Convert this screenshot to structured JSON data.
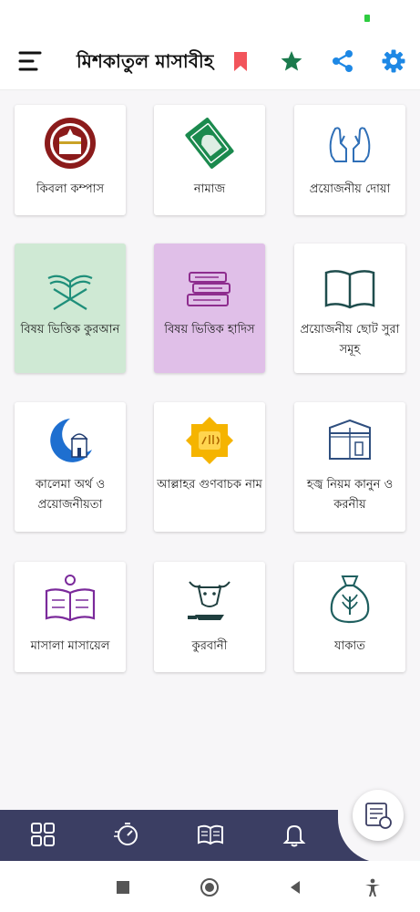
{
  "app": {
    "title": "মিশকাতুল মাসাবীহ"
  },
  "colors": {
    "accent_blue": "#1e88e5",
    "bookmark_red": "#f2545b",
    "star_green": "#1b7a4d",
    "nav_bg": "#3b3e63",
    "card_highlight_green": "#cfe9d4",
    "card_highlight_purple": "#e0bfe8"
  },
  "header_icons": [
    "menu-icon",
    "bookmark-icon",
    "star-icon",
    "share-icon",
    "settings-icon"
  ],
  "cards": [
    {
      "label": "কিবলা কম্পাস",
      "icon": "kaaba-compass-icon"
    },
    {
      "label": "নামাজ",
      "icon": "prayer-mat-icon"
    },
    {
      "label": "প্রয়োজনীয় দোয়া",
      "icon": "praying-hands-icon"
    },
    {
      "label": "বিষয় ভিত্তিক কুরআন",
      "icon": "quran-stand-icon"
    },
    {
      "label": "বিষয় ভিত্তিক হাদিস",
      "icon": "books-stack-icon"
    },
    {
      "label": "প্রয়োজনীয় ছোট সুরা সমূহ",
      "icon": "open-book-icon"
    },
    {
      "label": "কালেমা অর্থ ও প্রয়োজনীয়তা",
      "icon": "moon-mosque-icon"
    },
    {
      "label": "আল্লাহর গুণবাচক নাম",
      "icon": "allah-badge-icon"
    },
    {
      "label": "হজ্ব নিয়ম কানুন ও করনীয়",
      "icon": "kaaba-icon"
    },
    {
      "label": "মাসালা মাসায়েল",
      "icon": "idea-book-icon"
    },
    {
      "label": "কুরবানী",
      "icon": "cow-knife-icon"
    },
    {
      "label": "যাকাত",
      "icon": "money-bag-icon"
    }
  ],
  "bottom_nav": [
    "grid-icon",
    "timer-icon",
    "book-icon",
    "bell-icon",
    "book-list-icon"
  ],
  "system_nav": [
    "square-icon",
    "circle-icon",
    "back-icon",
    "accessibility-icon"
  ]
}
